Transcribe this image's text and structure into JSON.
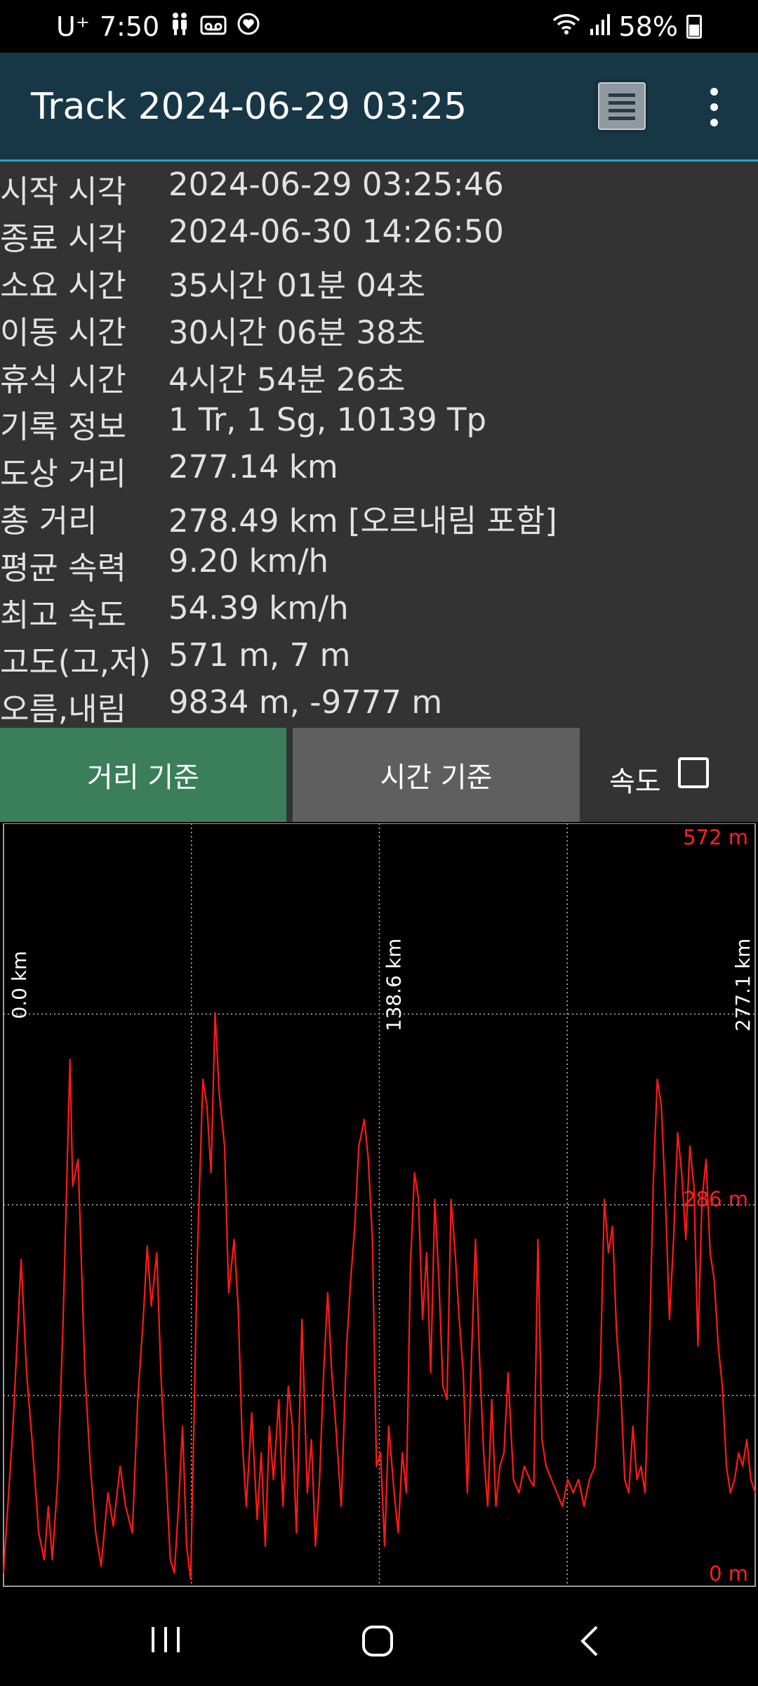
{
  "status_bar": {
    "carrier": "U⁺",
    "time": "7:50",
    "battery": "58%",
    "icons": [
      "person-icon",
      "voicemail-icon",
      "heart-sync-icon",
      "wifi-icon",
      "signal-icon",
      "battery-icon"
    ]
  },
  "app_bar": {
    "title": "Track 2024-06-29 03:25",
    "icons": [
      "list-view-icon",
      "more-vert-icon"
    ]
  },
  "stats": [
    {
      "label": "시작 시각",
      "value": "2024-06-29 03:25:46"
    },
    {
      "label": "종료 시각",
      "value": "2024-06-30 14:26:50"
    },
    {
      "label": "소요 시간",
      "value": "35시간 01분 04초"
    },
    {
      "label": "이동 시간",
      "value": "30시간 06분 38초"
    },
    {
      "label": "휴식 시간",
      "value": "4시간 54분 26초"
    },
    {
      "label": "기록 정보",
      "value": "1 Tr, 1 Sg, 10139 Tp"
    },
    {
      "label": "도상 거리",
      "value": "277.14 km"
    },
    {
      "label": "총 거리",
      "value": "278.49 km [오르내림 포함]"
    },
    {
      "label": "평균 속력",
      "value": "9.20 km/h"
    },
    {
      "label": "최고 속도",
      "value": "54.39 km/h"
    },
    {
      "label": "고도(고,저)",
      "value": "571 m, 7 m"
    },
    {
      "label": "오름,내림",
      "value": "9834 m, -9777 m"
    }
  ],
  "buttons": {
    "distance": "거리 기준",
    "time": "시간 기준",
    "speed_label": "속도",
    "speed_checked": false
  },
  "colors": {
    "app_bar": "#173746",
    "accent_line": "#2aa6c8",
    "panel": "#333333",
    "distance_button": "#3a7f5a",
    "time_button": "#5f5f5f",
    "plot_line": "#ff1a1a"
  },
  "chart_data": {
    "type": "line",
    "title": "",
    "xlabel": "",
    "ylabel": "",
    "x_unit": "km",
    "y_unit": "m",
    "xlim": [
      0,
      277.1
    ],
    "ylim": [
      0,
      572
    ],
    "x_tick_labels": [
      "0.0 km",
      "138.6 km",
      "277.1 km"
    ],
    "y_tick_labels": [
      "572 m",
      "286 m",
      "0 m"
    ],
    "grid": true,
    "series": [
      {
        "name": "",
        "points": [
          [
            0.0,
            10
          ],
          [
            3.5,
            120
          ],
          [
            6.5,
            245
          ],
          [
            8.5,
            160
          ],
          [
            10.5,
            110
          ],
          [
            13.0,
            40
          ],
          [
            15.0,
            20
          ],
          [
            16.5,
            60
          ],
          [
            18.0,
            20
          ],
          [
            20.0,
            80
          ],
          [
            22.0,
            200
          ],
          [
            24.5,
            395
          ],
          [
            25.5,
            300
          ],
          [
            27.5,
            320
          ],
          [
            30.0,
            160
          ],
          [
            32.0,
            90
          ],
          [
            34.0,
            40
          ],
          [
            36.0,
            15
          ],
          [
            38.5,
            70
          ],
          [
            40.5,
            45
          ],
          [
            43.0,
            90
          ],
          [
            45.0,
            60
          ],
          [
            47.5,
            40
          ],
          [
            49.5,
            140
          ],
          [
            51.5,
            200
          ],
          [
            53.0,
            255
          ],
          [
            54.5,
            210
          ],
          [
            56.5,
            250
          ],
          [
            58.0,
            160
          ],
          [
            60.0,
            80
          ],
          [
            61.5,
            20
          ],
          [
            63.0,
            10
          ],
          [
            64.5,
            60
          ],
          [
            66.0,
            120
          ],
          [
            67.5,
            30
          ],
          [
            69.0,
            5
          ],
          [
            71.5,
            250
          ],
          [
            73.5,
            380
          ],
          [
            75.0,
            360
          ],
          [
            76.5,
            310
          ],
          [
            78.0,
            430
          ],
          [
            79.5,
            370
          ],
          [
            80.5,
            350
          ],
          [
            81.5,
            330
          ],
          [
            83.0,
            220
          ],
          [
            85.0,
            260
          ],
          [
            86.5,
            210
          ],
          [
            88.0,
            110
          ],
          [
            89.5,
            60
          ],
          [
            91.5,
            130
          ],
          [
            93.5,
            50
          ],
          [
            95.0,
            100
          ],
          [
            96.5,
            30
          ],
          [
            98.0,
            120
          ],
          [
            99.5,
            80
          ],
          [
            101.5,
            140
          ],
          [
            103.0,
            60
          ],
          [
            105.0,
            150
          ],
          [
            106.5,
            120
          ],
          [
            108.0,
            40
          ],
          [
            110.0,
            200
          ],
          [
            112.0,
            70
          ],
          [
            113.5,
            110
          ],
          [
            115.0,
            30
          ],
          [
            116.5,
            80
          ],
          [
            118.0,
            160
          ],
          [
            119.5,
            220
          ],
          [
            121.0,
            160
          ],
          [
            122.5,
            120
          ],
          [
            124.5,
            60
          ],
          [
            126.5,
            180
          ],
          [
            128.0,
            230
          ],
          [
            129.5,
            270
          ],
          [
            131.0,
            330
          ],
          [
            133.0,
            350
          ],
          [
            134.5,
            320
          ],
          [
            136.0,
            260
          ],
          [
            137.5,
            90
          ],
          [
            139.0,
            100
          ],
          [
            140.5,
            30
          ],
          [
            142.0,
            120
          ],
          [
            144.0,
            70
          ],
          [
            145.5,
            40
          ],
          [
            147.0,
            100
          ],
          [
            148.5,
            70
          ],
          [
            150.0,
            240
          ],
          [
            151.5,
            310
          ],
          [
            153.0,
            290
          ],
          [
            154.5,
            200
          ],
          [
            156.0,
            250
          ],
          [
            157.5,
            160
          ],
          [
            159.0,
            290
          ],
          [
            160.5,
            230
          ],
          [
            162.0,
            150
          ],
          [
            163.5,
            140
          ],
          [
            165.0,
            290
          ],
          [
            166.5,
            250
          ],
          [
            168.0,
            200
          ],
          [
            169.5,
            160
          ],
          [
            171.0,
            70
          ],
          [
            172.5,
            170
          ],
          [
            174.0,
            260
          ],
          [
            175.5,
            170
          ],
          [
            177.0,
            100
          ],
          [
            178.5,
            60
          ],
          [
            180.0,
            140
          ],
          [
            181.5,
            60
          ],
          [
            183.0,
            90
          ],
          [
            184.5,
            100
          ],
          [
            186.0,
            160
          ],
          [
            188.0,
            80
          ],
          [
            190.0,
            70
          ],
          [
            192.0,
            90
          ],
          [
            194.0,
            80
          ],
          [
            195.5,
            75
          ],
          [
            197.0,
            260
          ],
          [
            198.5,
            110
          ],
          [
            200.0,
            90
          ],
          [
            202.0,
            80
          ],
          [
            204.0,
            70
          ],
          [
            206.0,
            60
          ],
          [
            208.0,
            80
          ],
          [
            210.0,
            70
          ],
          [
            212.0,
            80
          ],
          [
            214.0,
            60
          ],
          [
            216.0,
            80
          ],
          [
            218.0,
            90
          ],
          [
            220.0,
            160
          ],
          [
            221.5,
            290
          ],
          [
            223.0,
            250
          ],
          [
            224.5,
            270
          ],
          [
            226.0,
            190
          ],
          [
            227.5,
            150
          ],
          [
            229.0,
            80
          ],
          [
            230.5,
            70
          ],
          [
            232.0,
            120
          ],
          [
            233.5,
            80
          ],
          [
            235.0,
            90
          ],
          [
            236.5,
            70
          ],
          [
            238.0,
            170
          ],
          [
            239.5,
            300
          ],
          [
            241.0,
            380
          ],
          [
            242.5,
            360
          ],
          [
            244.0,
            290
          ],
          [
            245.5,
            200
          ],
          [
            247.0,
            260
          ],
          [
            248.5,
            340
          ],
          [
            250.0,
            310
          ],
          [
            251.5,
            260
          ],
          [
            253.0,
            330
          ],
          [
            254.5,
            300
          ],
          [
            256.0,
            180
          ],
          [
            257.5,
            290
          ],
          [
            259.0,
            320
          ],
          [
            260.5,
            250
          ],
          [
            262.0,
            230
          ],
          [
            263.5,
            180
          ],
          [
            265.0,
            150
          ],
          [
            266.5,
            90
          ],
          [
            268.0,
            70
          ],
          [
            269.5,
            80
          ],
          [
            271.0,
            100
          ],
          [
            272.5,
            90
          ],
          [
            274.0,
            110
          ],
          [
            275.5,
            80
          ],
          [
            277.1,
            70
          ]
        ]
      }
    ]
  }
}
